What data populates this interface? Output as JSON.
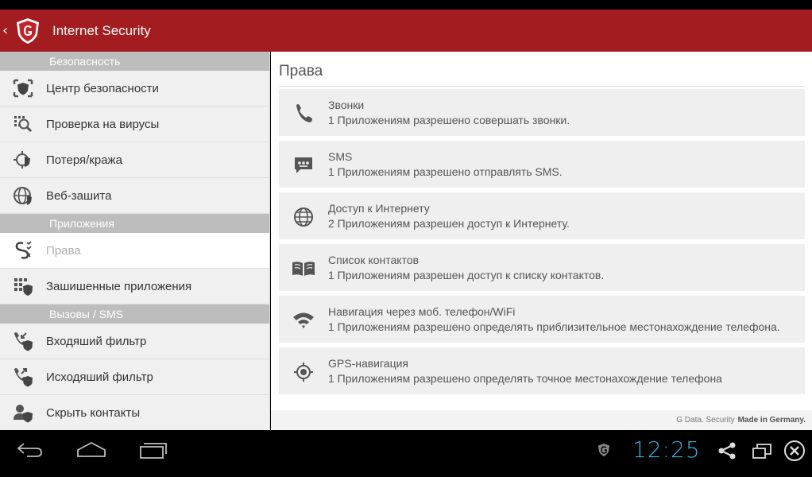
{
  "app": {
    "back_glyph": "‹",
    "title": "Internet Security",
    "brand_color": "#a31c1f"
  },
  "sidebar": {
    "sections": [
      {
        "header": "Безопасность",
        "items": [
          {
            "label": "Центр безопасности",
            "icon": "security-center-icon"
          },
          {
            "label": "Проверка на вирусы",
            "icon": "virus-scan-icon"
          },
          {
            "label": "Потеря/кража",
            "icon": "loss-theft-icon"
          },
          {
            "label": "Веб-зашита",
            "icon": "web-protection-icon"
          }
        ]
      },
      {
        "header": "Приложения",
        "items": [
          {
            "label": "Права",
            "icon": "permissions-icon",
            "active": true
          },
          {
            "label": "Зашишенные приложения",
            "icon": "protected-apps-icon"
          }
        ]
      },
      {
        "header": "Вызовы / SMS",
        "items": [
          {
            "label": "Входяший фильтр",
            "icon": "incoming-filter-icon"
          },
          {
            "label": "Исходяший фильтр",
            "icon": "outgoing-filter-icon"
          },
          {
            "label": "Скрыть контакты",
            "icon": "hide-contacts-icon"
          }
        ]
      }
    ]
  },
  "content": {
    "heading": "Права",
    "permissions": [
      {
        "title": "Звонки",
        "desc": "1 Приложениям разрешено совершать звонки.",
        "icon": "phone-icon"
      },
      {
        "title": "SMS",
        "desc": "1 Приложениям разрешено отправлять SMS.",
        "icon": "sms-icon"
      },
      {
        "title": "Доступ к Интернету",
        "desc": "2 Приложениям разрешен доступ к Интернету.",
        "icon": "globe-icon"
      },
      {
        "title": "Список контактов",
        "desc": "1 Приложениям разрешен доступ к списку контактов.",
        "icon": "contacts-book-icon"
      },
      {
        "title": "Навигация через моб. телефон/WiFi",
        "desc": "1 Приложениям разрешено определять приблизительное местонахождение телефона.",
        "icon": "wifi-icon"
      },
      {
        "title": "GPS-навигация",
        "desc": "1 Приложениям разрешено определять точное местонахождение телефона",
        "icon": "gps-icon"
      }
    ]
  },
  "footer": {
    "text": "G Data. Security",
    "bold": "Made in Germany."
  },
  "system_bar": {
    "clock": "12:25",
    "clock_color": "#33b5e5"
  }
}
